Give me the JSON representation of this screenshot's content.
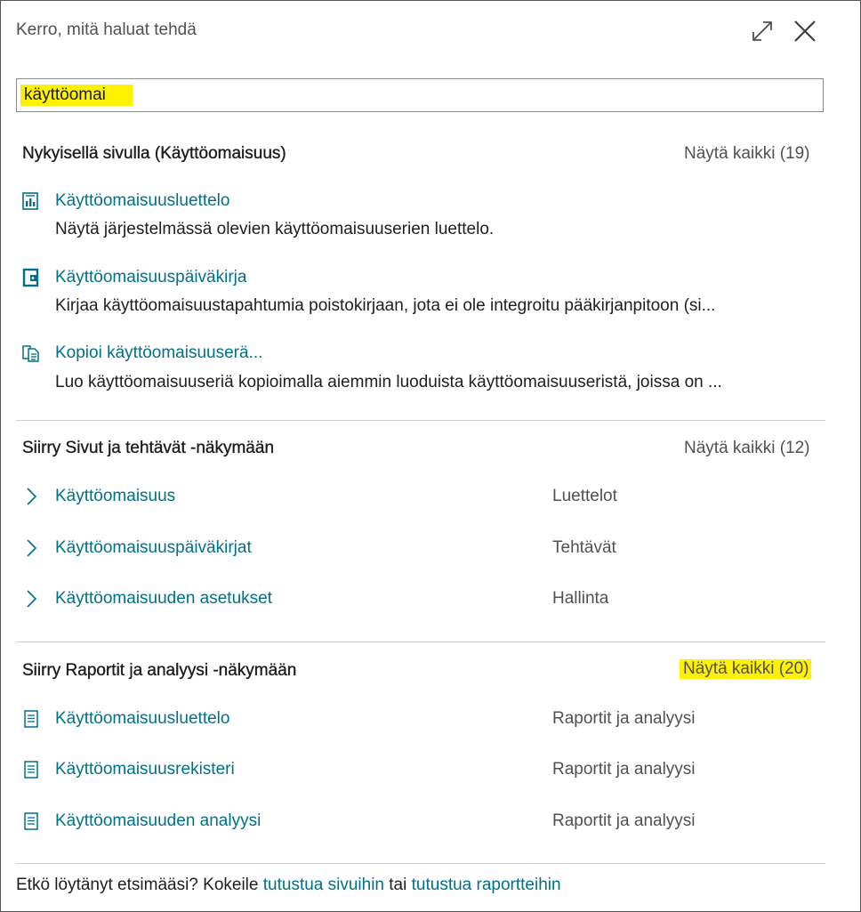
{
  "dialog": {
    "title": "Kerro, mitä haluat tehdä"
  },
  "search": {
    "value": "käyttöomai"
  },
  "sections": {
    "current_page": {
      "heading": "Nykyisellä sivulla (Käyttöomaisuus)",
      "see_all": "Näytä kaikki (19)",
      "items": [
        {
          "label": "Käyttöomaisuusluettelo",
          "description": "Näytä järjestelmässä olevien käyttöomaisuuserien luettelo.",
          "icon": "list-report-icon"
        },
        {
          "label": "Käyttöomaisuuspäiväkirja",
          "description": "Kirjaa käyttöomaisuustapahtumia poistokirjaan, jota ei ole integroitu pääkirjanpitoon (si...",
          "icon": "journal-icon"
        },
        {
          "label": "Kopioi käyttöomaisuuserä...",
          "description": "Luo käyttöomaisuuseriä kopioimalla aiemmin luoduista käyttöomaisuuseristä, joissa on ...",
          "icon": "copy-document-icon"
        }
      ]
    },
    "pages_tasks": {
      "heading": "Siirry Sivut ja tehtävät -näkymään",
      "see_all": "Näytä kaikki (12)",
      "items": [
        {
          "label": "Käyttöomaisuus",
          "category": "Luettelot",
          "icon": "chevron-right-icon"
        },
        {
          "label": "Käyttöomaisuuspäiväkirjat",
          "category": "Tehtävät",
          "icon": "chevron-right-icon"
        },
        {
          "label": "Käyttöomaisuuden asetukset",
          "category": "Hallinta",
          "icon": "chevron-right-icon"
        }
      ]
    },
    "reports": {
      "heading": "Siirry Raportit ja analyysi -näkymään",
      "see_all": "Näytä kaikki (20)",
      "items": [
        {
          "label": "Käyttöomaisuusluettelo",
          "category": "Raportit ja analyysi",
          "icon": "report-icon"
        },
        {
          "label": "Käyttöomaisuusrekisteri",
          "category": "Raportit ja analyysi",
          "icon": "report-icon"
        },
        {
          "label": "Käyttöomaisuuden analyysi",
          "category": "Raportit ja analyysi",
          "icon": "report-icon"
        }
      ]
    }
  },
  "footer": {
    "text_before": "Etkö löytänyt etsimääsi? Kokeile ",
    "link_pages": "tutustua sivuihin",
    "text_middle": " tai ",
    "link_reports": "tutustua raportteihin"
  },
  "colors": {
    "link": "#00708a",
    "highlight": "#fff200",
    "muted": "#505050",
    "divider": "#d0d0d0"
  }
}
